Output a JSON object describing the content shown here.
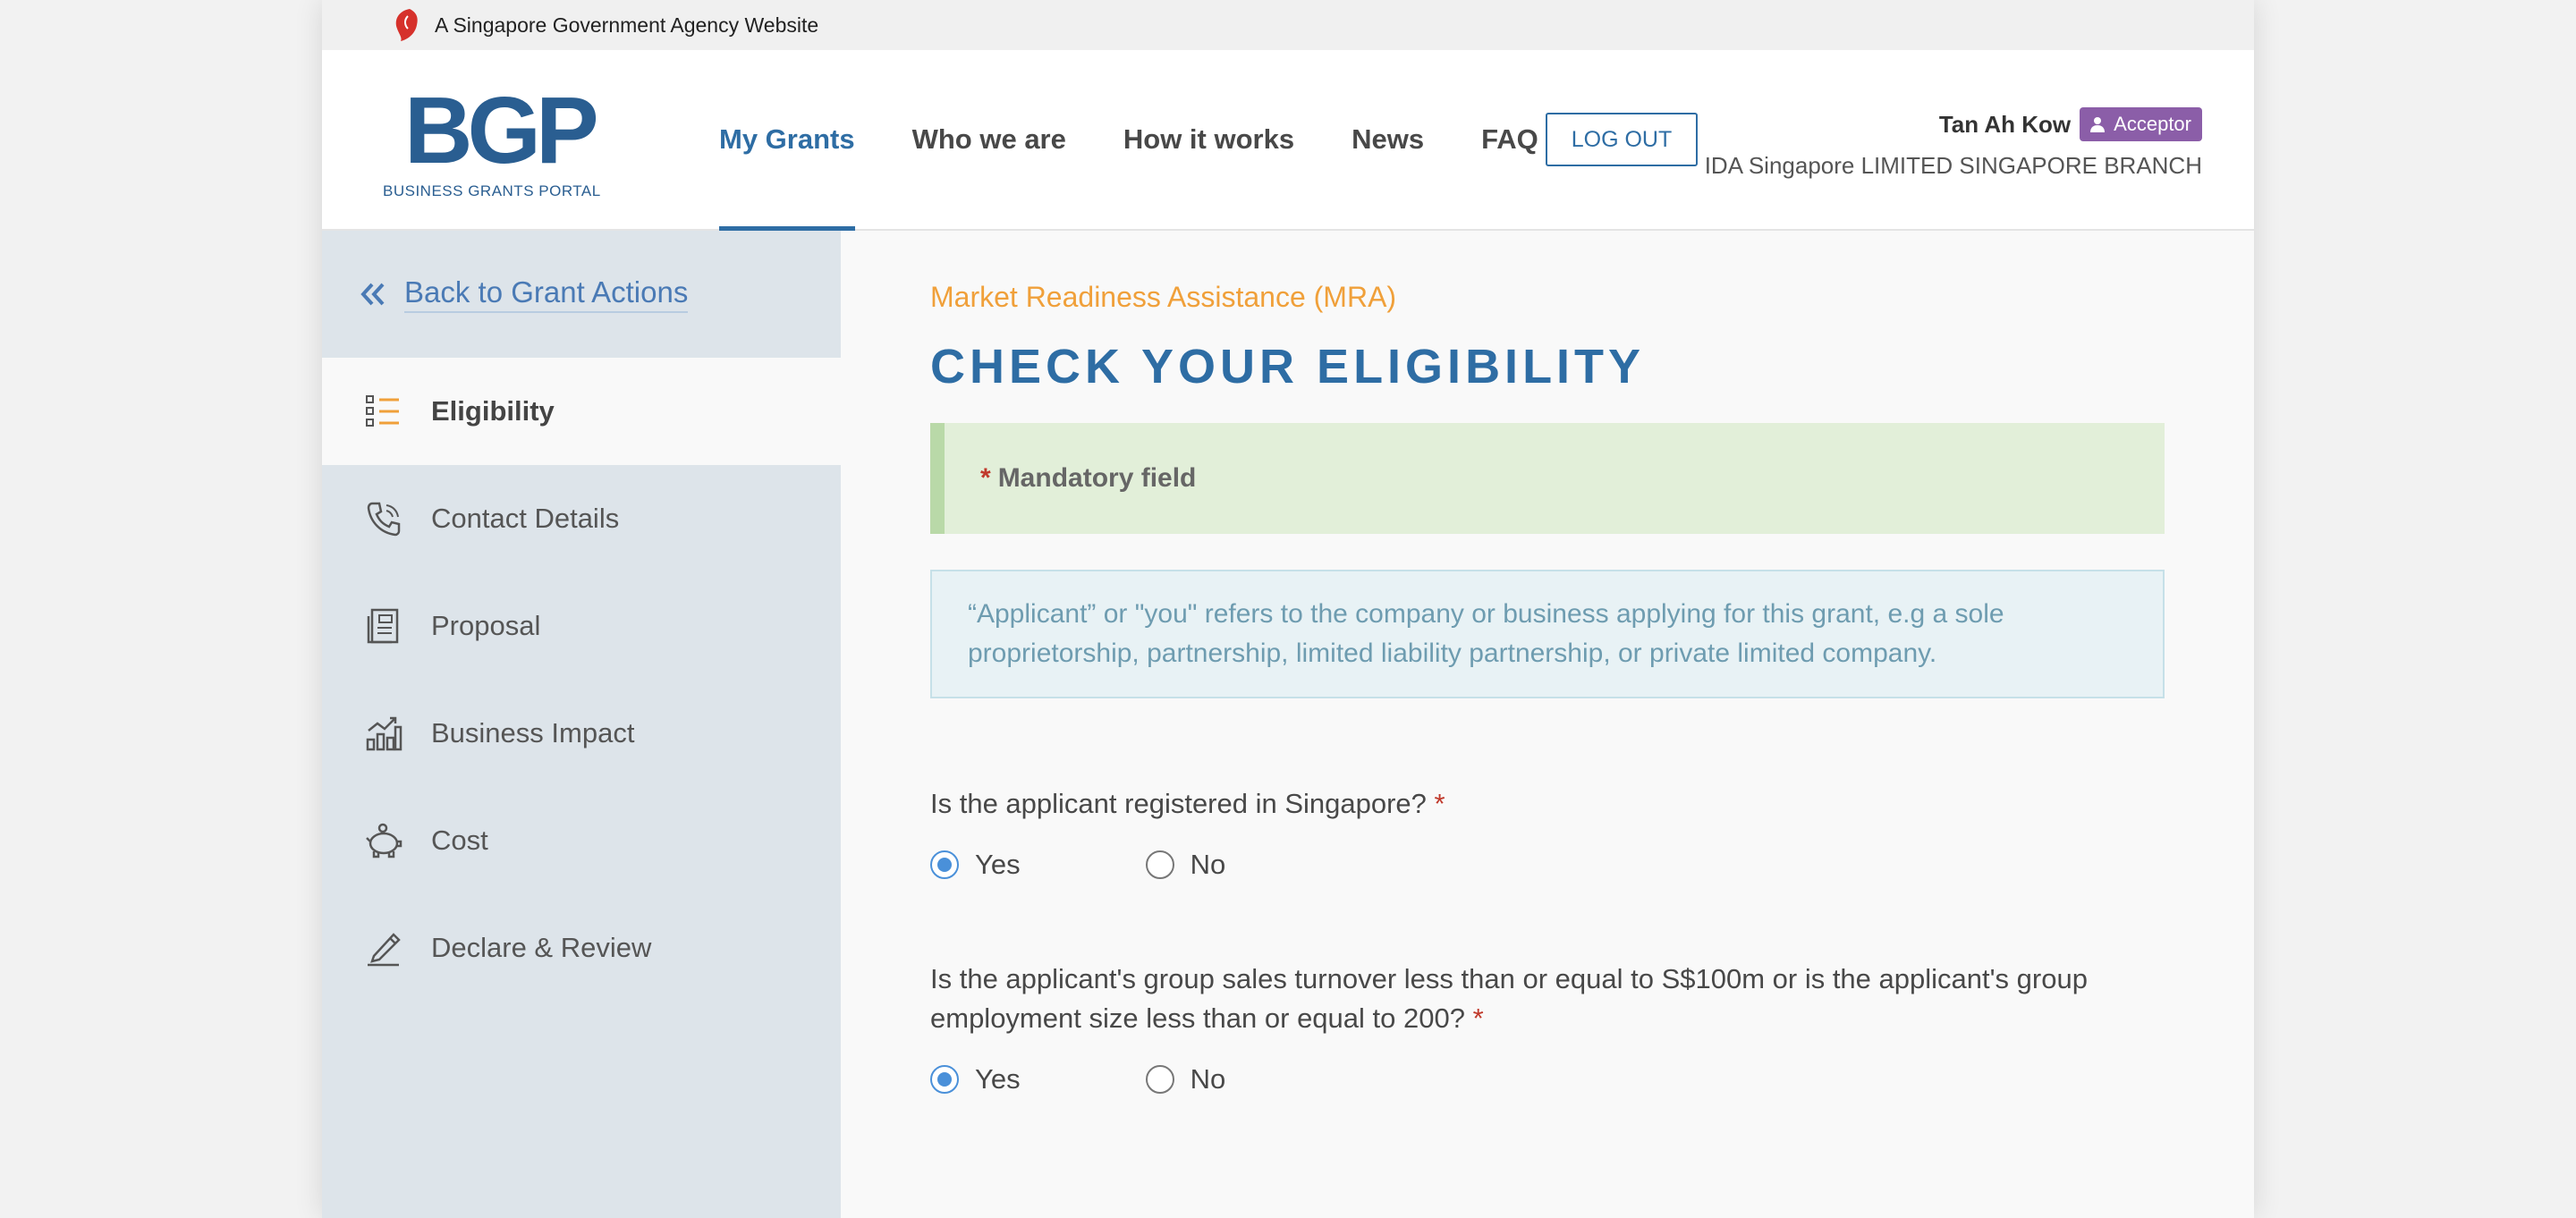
{
  "masthead": {
    "text": "A Singapore Government Agency Website"
  },
  "logo": {
    "mark": "BGP",
    "subtitle": "BUSINESS GRANTS PORTAL"
  },
  "nav": {
    "items": [
      {
        "label": "My Grants",
        "active": true
      },
      {
        "label": "Who we are"
      },
      {
        "label": "How it works"
      },
      {
        "label": "News"
      },
      {
        "label": "FAQ"
      }
    ],
    "logout_label": "LOG OUT"
  },
  "user": {
    "name": "Tan Ah Kow",
    "role": "Acceptor",
    "organisation": "IDA Singapore LIMITED SINGAPORE BRANCH"
  },
  "sidebar": {
    "back_label": "Back to Grant Actions",
    "items": [
      {
        "label": "Eligibility",
        "icon": "list-icon",
        "active": true
      },
      {
        "label": "Contact Details",
        "icon": "phone-icon"
      },
      {
        "label": "Proposal",
        "icon": "document-icon"
      },
      {
        "label": "Business Impact",
        "icon": "chart-icon"
      },
      {
        "label": "Cost",
        "icon": "piggy-bank-icon"
      },
      {
        "label": "Declare & Review",
        "icon": "pen-icon"
      }
    ]
  },
  "main": {
    "breadcrumb": "Market Readiness Assistance (MRA)",
    "title": "CHECK YOUR ELIGIBILITY",
    "mandatory_note": "Mandatory field",
    "info_text": "“Applicant” or \"you\" refers to the company or business applying for this grant, e.g a sole proprietorship, partnership, limited liability partnership, or private limited company.",
    "questions": [
      {
        "text": "Is the applicant registered in Singapore?",
        "options": [
          "Yes",
          "No"
        ],
        "selected": "Yes"
      },
      {
        "text": "Is the applicant's group sales turnover less than or equal to S$100m or is the applicant's group employment size less than or equal to 200?",
        "options": [
          "Yes",
          "No"
        ],
        "selected": "Yes"
      }
    ]
  },
  "colors": {
    "accent": "#2e6da4",
    "breadcrumb": "#f0a03a",
    "badge": "#8b5ea8",
    "mandatory_bg": "#e2efd9",
    "info_bg": "#e8f2f5"
  }
}
